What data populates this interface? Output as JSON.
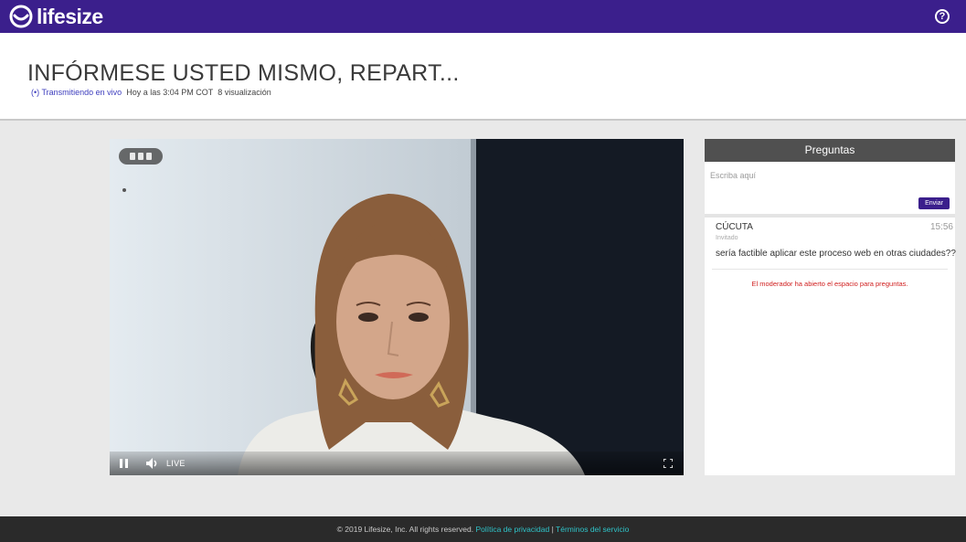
{
  "brand": {
    "name": "lifesize"
  },
  "header": {
    "help_glyph": "?",
    "title": "INFÓRMESE USTED MISMO, REPART...",
    "live_indicator": "(•) Transmitiendo en vivo",
    "date": "Hoy a las 3:04 PM COT",
    "views": "8 visualización"
  },
  "player": {
    "live_label": "LIVE",
    "icons": [
      "pause-icon",
      "volume-icon",
      "fullscreen-icon",
      "participants-badge-icon"
    ]
  },
  "questions": {
    "title": "Preguntas",
    "input_placeholder": "Escriba aquí",
    "send_label": "Enviar",
    "messages": [
      {
        "author": "CÚCUTA",
        "role": "Invitado",
        "time": "15:56",
        "text": "sería factible aplicar este proceso web en otras ciudades??"
      }
    ],
    "system_message": "El moderador ha abierto el espacio para preguntas."
  },
  "footer": {
    "copyright": "© 2019 Lifesize, Inc. All rights reserved.",
    "privacy_link": "Política de privacidad",
    "separator": "|",
    "terms_link": "Términos del servicio"
  },
  "colors": {
    "brand": "#3b1f8c",
    "panel_header": "#505050",
    "footer_bg": "#2a2a2a",
    "footer_link": "#2fc3c8",
    "alert_text": "#d02020"
  }
}
